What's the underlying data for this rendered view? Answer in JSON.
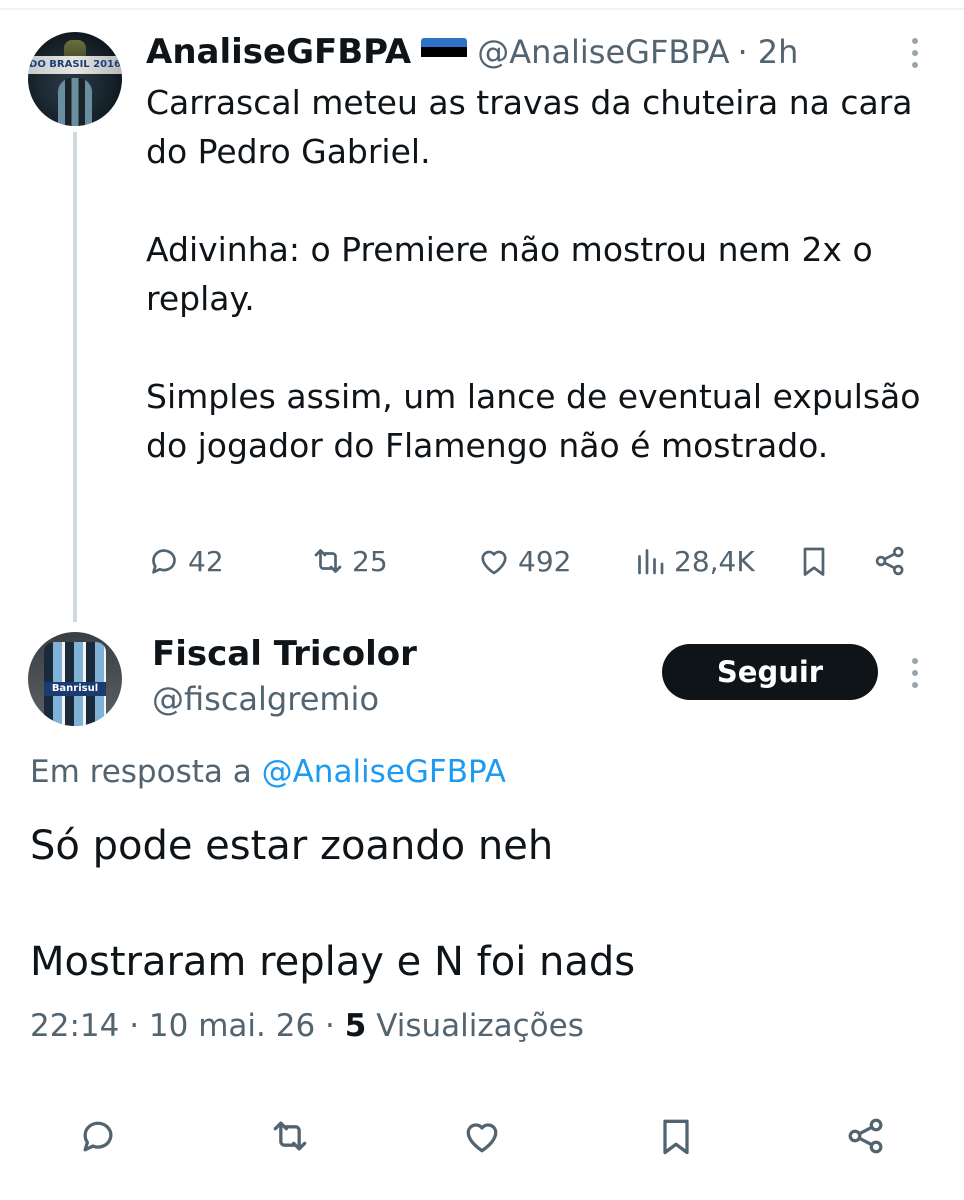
{
  "parent_tweet": {
    "author_name": "AnaliseGFBPA",
    "handle": "@AnaliseGFBPA",
    "time": "· 2h",
    "avatar_banner": "DO BRASIL 2016",
    "paragraphs": [
      "Carrascal meteu as travas da chuteira na cara do Pedro Gabriel.",
      "Adivinha: o Premiere não mostrou nem 2x o replay.",
      "Simples assim, um lance de eventual expulsão do jogador do Flamengo não é mostrado."
    ],
    "stats": {
      "replies": "42",
      "retweets": "25",
      "likes": "492",
      "views": "28,4K"
    }
  },
  "reply_tweet": {
    "author_name": "Fiscal Tricolor",
    "handle": "@fiscalgremio",
    "follow_label": "Seguir",
    "avatar_sponsor": "Banrisul",
    "reply_to_prefix": "Em resposta a",
    "reply_to_handle": "@AnaliseGFBPA",
    "paragraphs": [
      "Só pode estar zoando neh",
      "Mostraram replay e N foi nads"
    ],
    "time": "22:14",
    "date": "10 mai. 26",
    "views_count": "5",
    "views_label": "Visualizações"
  },
  "colors": {
    "text": "#0f1419",
    "secondary": "#536471",
    "accent": "#1d9bf0",
    "button": "#0f1419"
  },
  "icons": {
    "reply": "reply-icon",
    "retweet": "retweet-icon",
    "like": "heart-icon",
    "views": "views-icon",
    "bookmark": "bookmark-icon",
    "share": "share-icon",
    "more": "more-icon"
  }
}
